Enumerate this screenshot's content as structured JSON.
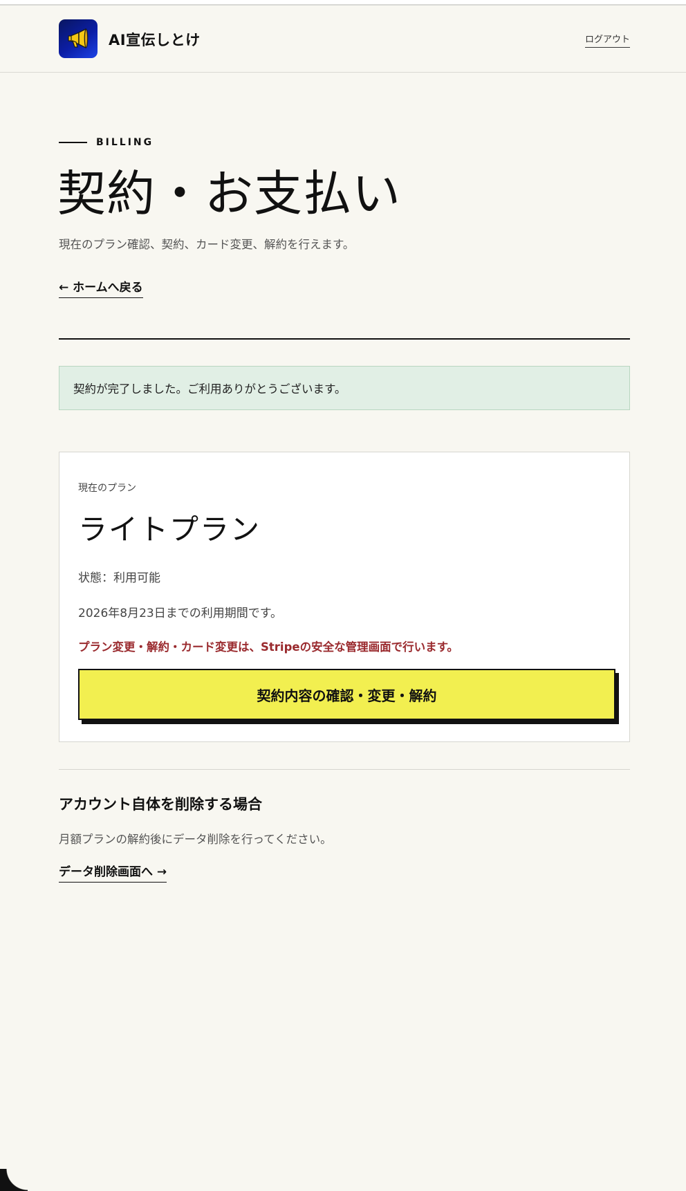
{
  "app": {
    "name": "AI宣伝しとけ",
    "logo_icon": "megaphone-icon"
  },
  "header": {
    "logout_label": "ログアウト"
  },
  "page": {
    "eyebrow": "BILLING",
    "title": "契約・お支払い",
    "subtitle": "現在のプラン確認、契約、カード変更、解約を行えます。",
    "back_link": "← ホームへ戻る"
  },
  "notice": {
    "text": "契約が完了しました。ご利用ありがとうございます。"
  },
  "plan": {
    "label": "現在のプラン",
    "name": "ライトプラン",
    "status": "状態：利用可能",
    "period": "2026年8月23日までの利用期間です。",
    "note": "プラン変更・解約・カード変更は、Stripeの安全な管理画面で行います。",
    "manage_button": "契約内容の確認・変更・解約"
  },
  "delete_section": {
    "title": "アカウント自体を削除する場合",
    "description": "月額プランの解約後にデータ削除を行ってください。",
    "link": "データ削除画面へ →"
  },
  "colors": {
    "background": "#f8f7f1",
    "accent_yellow": "#f2ef50",
    "success_bg": "#e1efe5",
    "warning_text": "#9a2a2e"
  }
}
